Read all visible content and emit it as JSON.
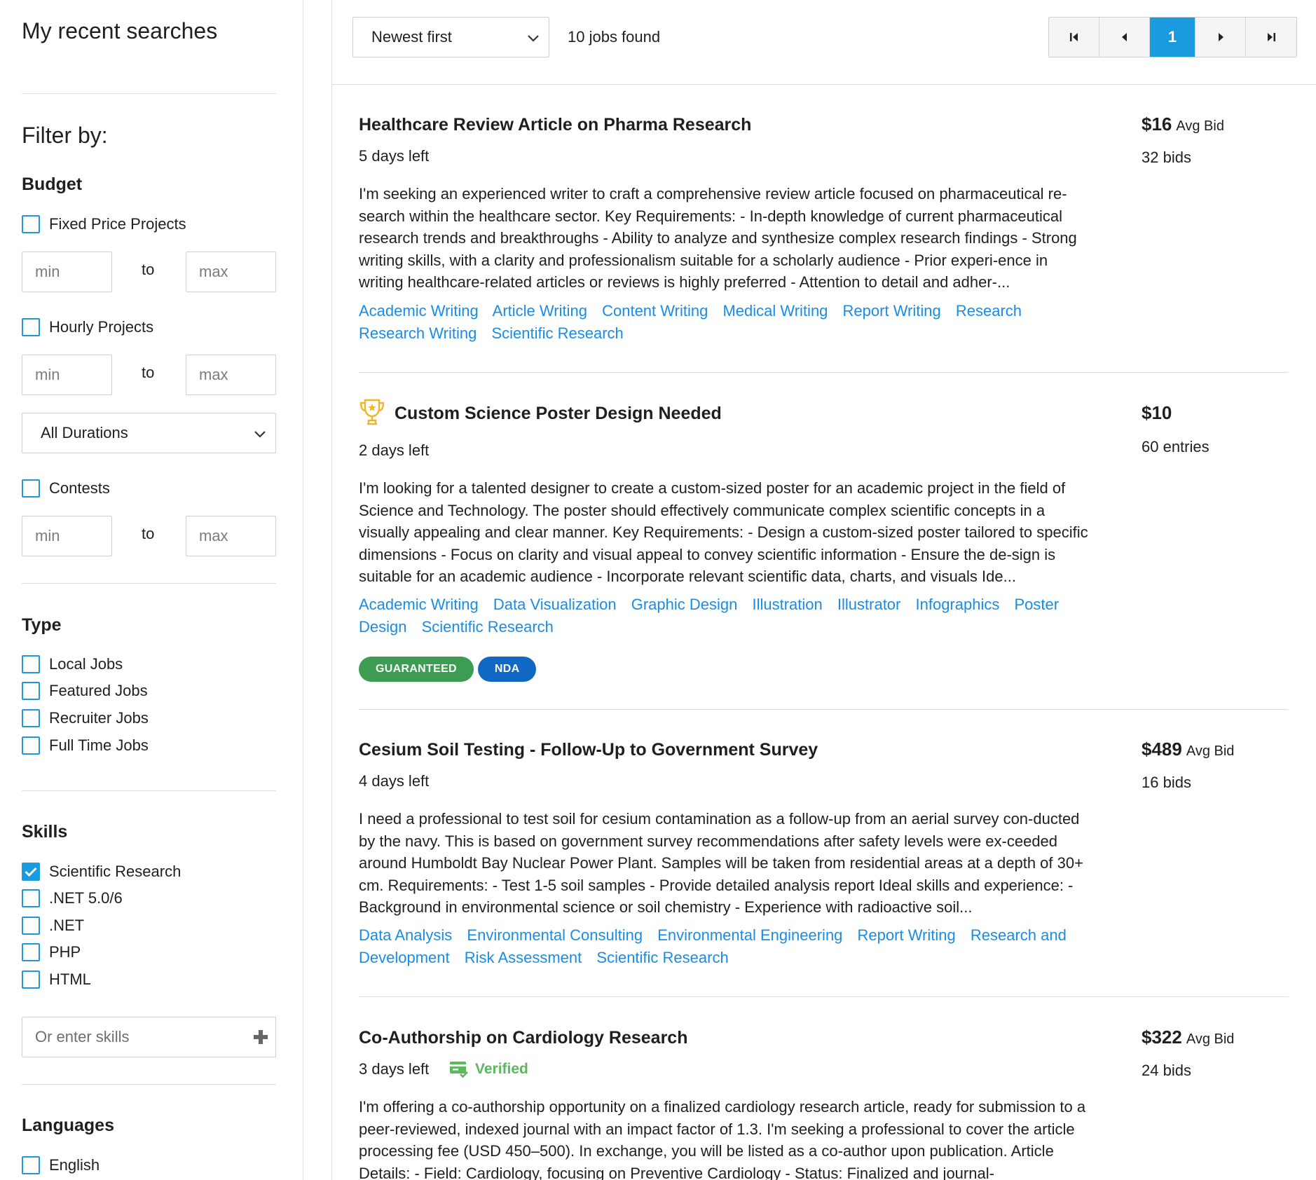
{
  "sidebar": {
    "recent_searches_title": "My recent searches",
    "filter_title": "Filter by:",
    "budget": {
      "title": "Budget",
      "fixed_label": "Fixed Price Projects",
      "fixed_checked": false,
      "hourly_label": "Hourly Projects",
      "hourly_checked": false,
      "min_placeholder": "min",
      "max_placeholder": "max",
      "to_label": "to",
      "duration_selected": "All Durations",
      "contests_label": "Contests",
      "contests_checked": false
    },
    "type": {
      "title": "Type",
      "items": [
        {
          "label": "Local Jobs",
          "checked": false
        },
        {
          "label": "Featured Jobs",
          "checked": false
        },
        {
          "label": "Recruiter Jobs",
          "checked": false
        },
        {
          "label": "Full Time Jobs",
          "checked": false
        }
      ]
    },
    "skills": {
      "title": "Skills",
      "items": [
        {
          "label": "Scientific Research",
          "checked": true
        },
        {
          "label": ".NET 5.0/6",
          "checked": false
        },
        {
          "label": ".NET",
          "checked": false
        },
        {
          "label": "PHP",
          "checked": false
        },
        {
          "label": "HTML",
          "checked": false
        }
      ],
      "input_placeholder": "Or enter skills"
    },
    "languages": {
      "title": "Languages",
      "items": [
        {
          "label": "English",
          "checked": false
        }
      ]
    }
  },
  "toolbar": {
    "sort_selected": "Newest first",
    "jobs_found": "10 jobs found",
    "pagination": {
      "first_icon": "first-page-icon",
      "prev_icon": "prev-page-icon",
      "current_page": "1",
      "next_icon": "next-page-icon",
      "last_icon": "last-page-icon"
    }
  },
  "colors": {
    "accent": "#1a9be0",
    "link": "#1a8ce5",
    "guaranteed": "#3c9c52",
    "nda": "#1167c4",
    "verified": "#5cb85c",
    "trophy": "#f0b429"
  },
  "jobs": [
    {
      "title": "Healthcare Review Article on Pharma Research",
      "days_left": "5 days left",
      "description": "I'm seeking an experienced writer to craft a comprehensive review article focused on pharmaceutical re-search within the healthcare sector. Key Requirements: - In-depth knowledge of current pharmaceutical research trends and breakthroughs - Ability to analyze and synthesize complex research findings - Strong writing skills, with a clarity and professionalism suitable for a scholarly audience - Prior experi-ence in writing healthcare-related articles or reviews is highly preferred - Attention to detail and adher-...",
      "tags": [
        "Academic Writing",
        "Article Writing",
        "Content Writing",
        "Medical Writing",
        "Report Writing",
        "Research",
        "Research Writing",
        "Scientific Research"
      ],
      "price": "$16",
      "price_suffix": "Avg Bid",
      "bids": "32 bids"
    },
    {
      "title": "Custom Science Poster Design Needed",
      "icon": "trophy-icon",
      "days_left": "2 days left",
      "description": "I'm looking for a talented designer to create a custom-sized poster for an academic project in the field of Science and Technology. The poster should effectively communicate complex scientific concepts in a visually appealing and clear manner. Key Requirements: - Design a custom-sized poster tailored to specific dimensions - Focus on clarity and visual appeal to convey scientific information - Ensure the de-sign is suitable for an academic audience - Incorporate relevant scientific data, charts, and visuals Ide...",
      "tags": [
        "Academic Writing",
        "Data Visualization",
        "Graphic Design",
        "Illustration",
        "Illustrator",
        "Infographics",
        "Poster Design",
        "Scientific Research"
      ],
      "badges": [
        "GUARANTEED",
        "NDA"
      ],
      "price": "$10",
      "bids": "60 entries"
    },
    {
      "title": "Cesium Soil Testing - Follow-Up to Government Survey",
      "days_left": "4 days left",
      "description": "I need a professional to test soil for cesium contamination as a follow-up from an aerial survey con-ducted by the navy. This is based on government survey recommendations after safety levels were ex-ceeded around Humboldt Bay Nuclear Power Plant. Samples will be taken from residential areas at a depth of 30+ cm. Requirements: - Test 1-5 soil samples - Provide detailed analysis report Ideal skills and experience: - Background in environmental science or soil chemistry - Experience with radioactive soil...",
      "tags": [
        "Data Analysis",
        "Environmental Consulting",
        "Environmental Engineering",
        "Report Writing",
        "Research and Development",
        "Risk Assessment",
        "Scientific Research"
      ],
      "price": "$489",
      "price_suffix": "Avg Bid",
      "bids": "16 bids"
    },
    {
      "title": "Co-Authorship on Cardiology Research",
      "days_left": "3 days left",
      "verified_label": "Verified",
      "description": "I'm offering a co-authorship opportunity on a finalized cardiology research article, ready for submission to a peer-reviewed, indexed journal with an impact factor of 1.3. I'm seeking a professional to cover the article processing fee (USD 450–500). In exchange, you will be listed as a co-author upon publication. Article Details: - Field: Cardiology, focusing on Preventive Cardiology - Status: Finalized and journal-",
      "price": "$322",
      "price_suffix": "Avg Bid",
      "bids": "24 bids"
    }
  ]
}
